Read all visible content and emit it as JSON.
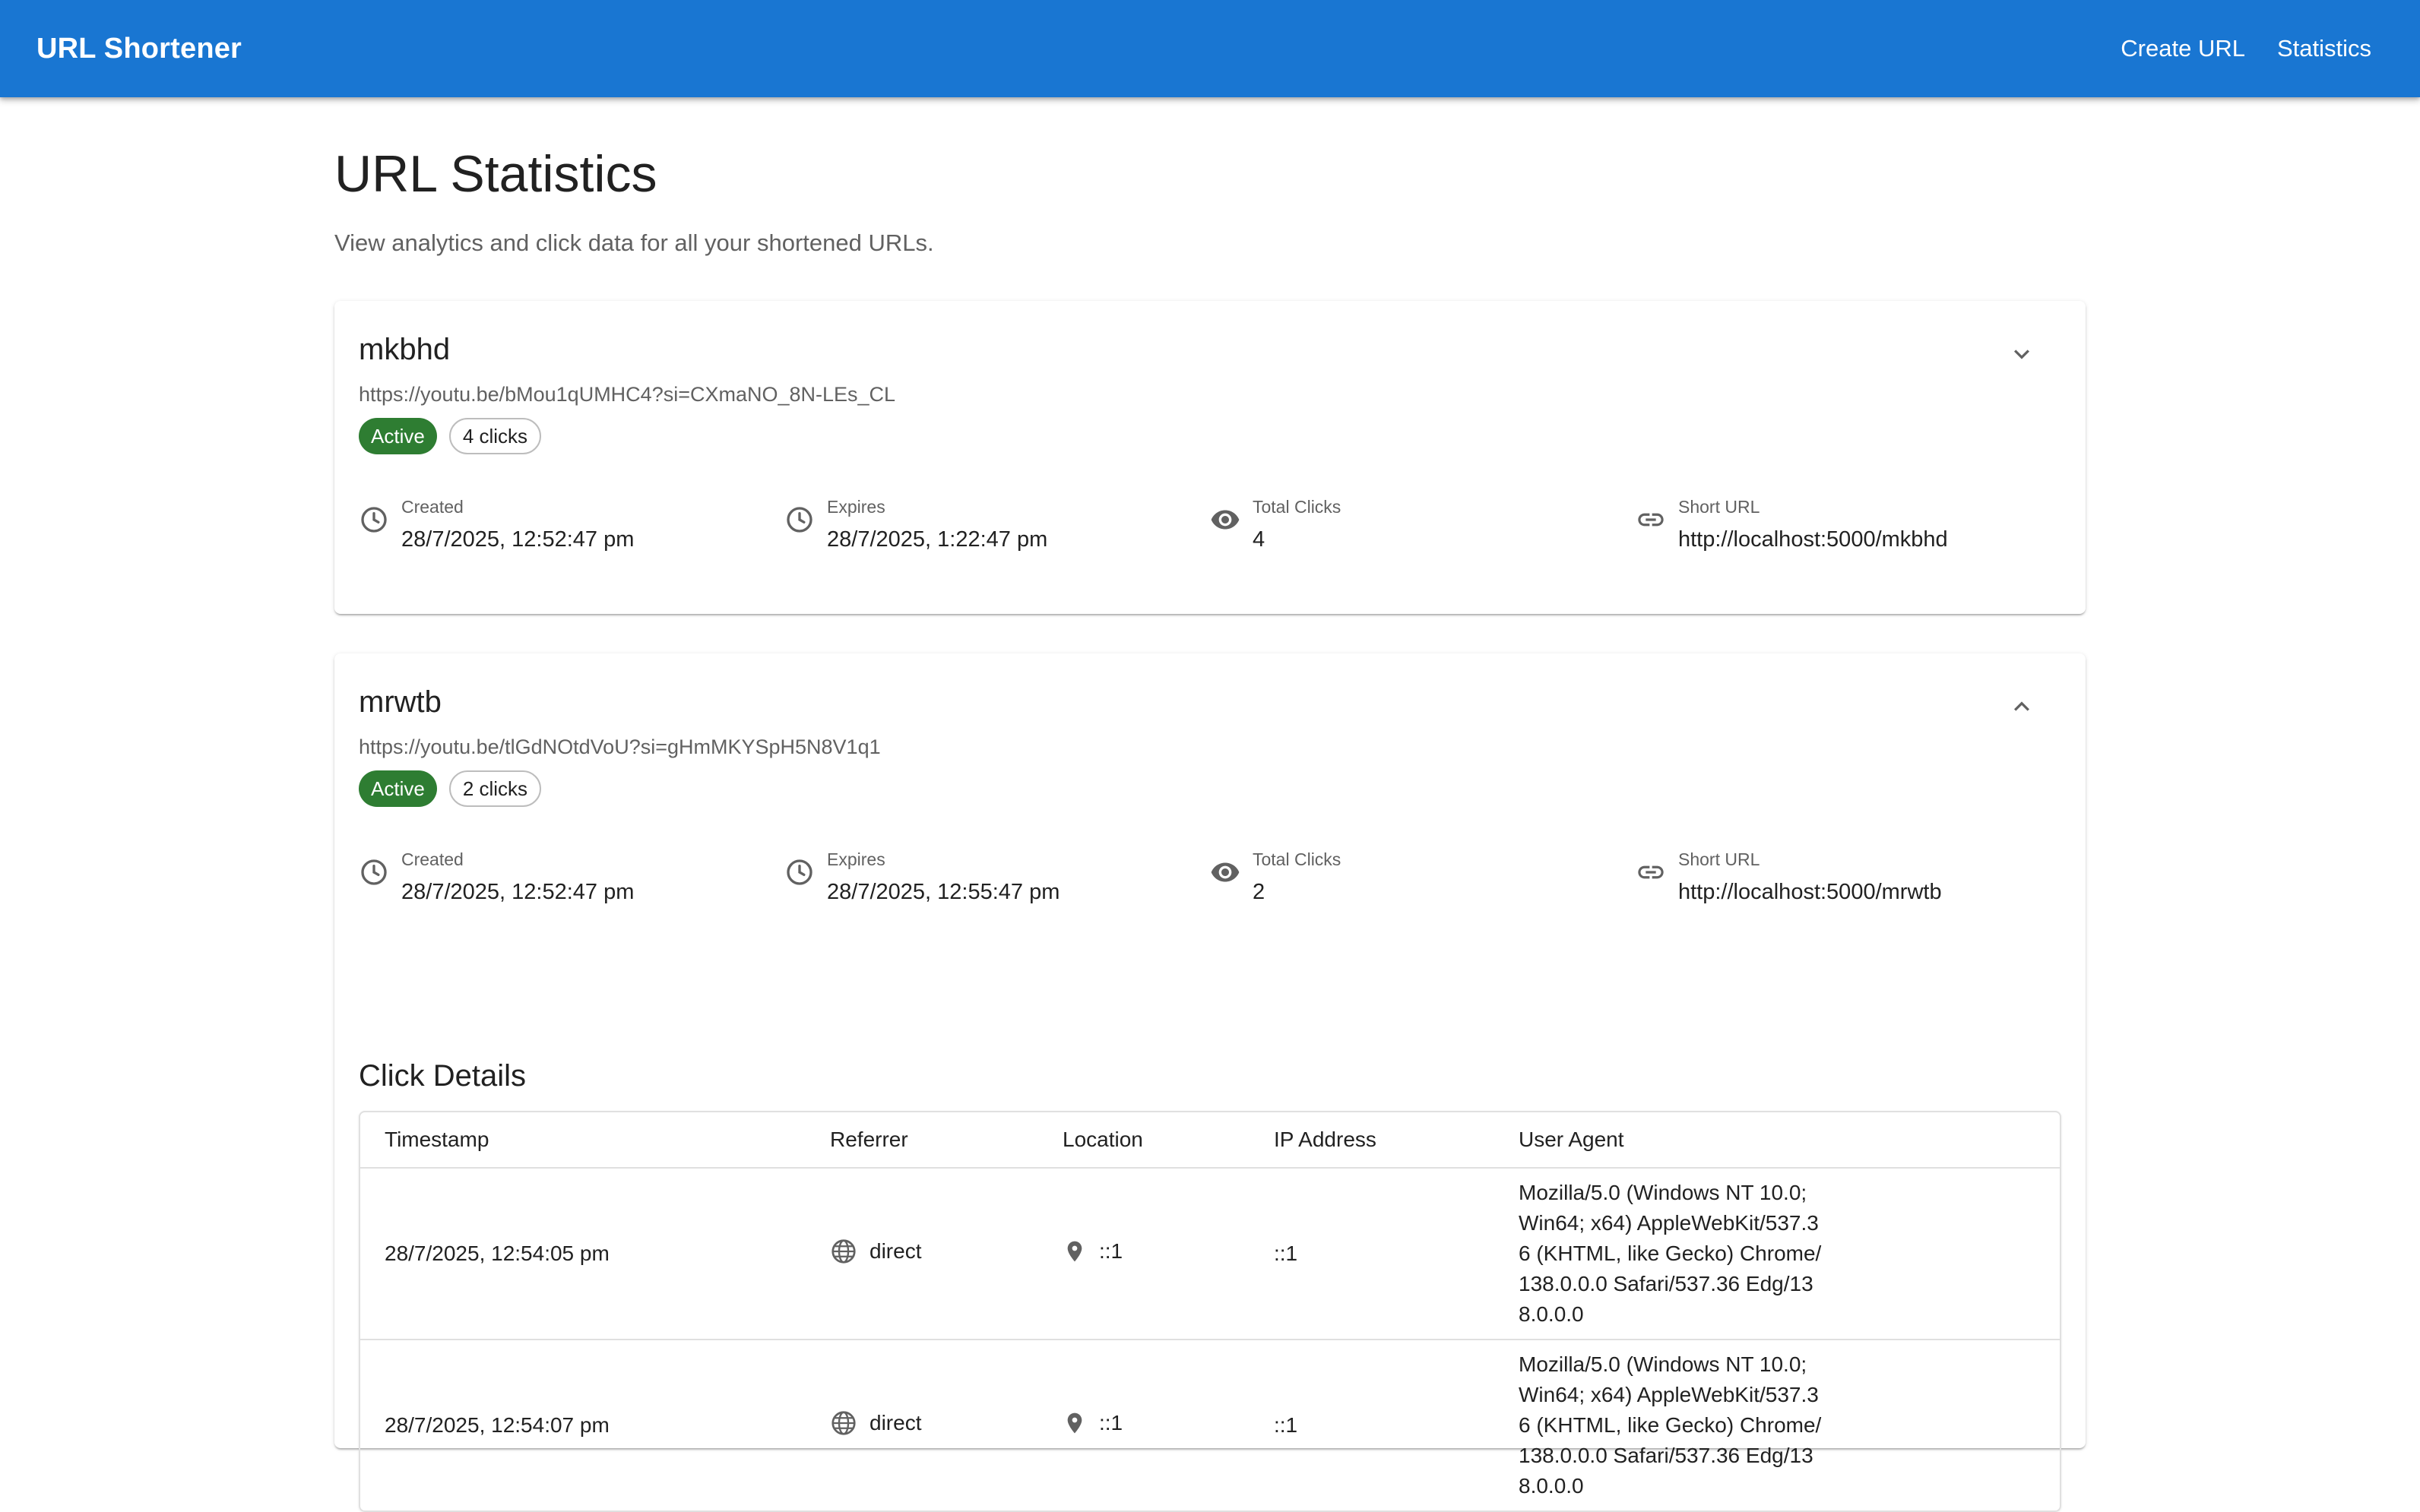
{
  "app": {
    "title": "URL Shortener",
    "nav": [
      "Create URL",
      "Statistics"
    ],
    "accent_color": "#1976d2"
  },
  "page": {
    "title": "URL Statistics",
    "subtitle": "View analytics and click data for all your shortened URLs."
  },
  "urls": [
    {
      "code": "mkbhd",
      "original_url": "https://youtu.be/bMou1qUMHC4?si=CXmaNO_8N-LEs_CL",
      "status": "Active",
      "clicks_chip": "4 clicks",
      "expand_icon": "chevron-down-icon",
      "stats": {
        "created_label": "Created",
        "created_value": "28/7/2025, 12:52:47 pm",
        "expires_label": "Expires",
        "expires_value": "28/7/2025, 1:22:47 pm",
        "total_label": "Total Clicks",
        "total_value": "4",
        "short_label": "Short URL",
        "short_value": "http://localhost:5000/mkbhd"
      }
    },
    {
      "code": "mrwtb",
      "original_url": "https://youtu.be/tlGdNOtdVoU?si=gHmMKYSpH5N8V1q1",
      "status": "Active",
      "clicks_chip": "2 clicks",
      "expand_icon": "chevron-up-icon",
      "stats": {
        "created_label": "Created",
        "created_value": "28/7/2025, 12:52:47 pm",
        "expires_label": "Expires",
        "expires_value": "28/7/2025, 12:55:47 pm",
        "total_label": "Total Clicks",
        "total_value": "2",
        "short_label": "Short URL",
        "short_value": "http://localhost:5000/mrwtb"
      },
      "click_details": {
        "title": "Click Details",
        "columns": [
          "Timestamp",
          "Referrer",
          "Location",
          "IP Address",
          "User Agent"
        ],
        "rows": [
          {
            "timestamp": "28/7/2025, 12:54:05 pm",
            "referrer": "direct",
            "location": "::1",
            "ip": "::1",
            "user_agent": "Mozilla/5.0 (Windows NT 10.0; Win64; x64) AppleWebKit/537.36 (KHTML, like Gecko) Chrome/138.0.0.0 Safari/537.36 Edg/138.0.0.0"
          },
          {
            "timestamp": "28/7/2025, 12:54:07 pm",
            "referrer": "direct",
            "location": "::1",
            "ip": "::1",
            "user_agent": "Mozilla/5.0 (Windows NT 10.0; Win64; x64) AppleWebKit/537.36 (KHTML, like Gecko) Chrome/138.0.0.0 Safari/537.36 Edg/138.0.0.0"
          }
        ]
      }
    }
  ],
  "colors": {
    "status_active": "#2e7d32",
    "icon_gray": "#616161"
  }
}
